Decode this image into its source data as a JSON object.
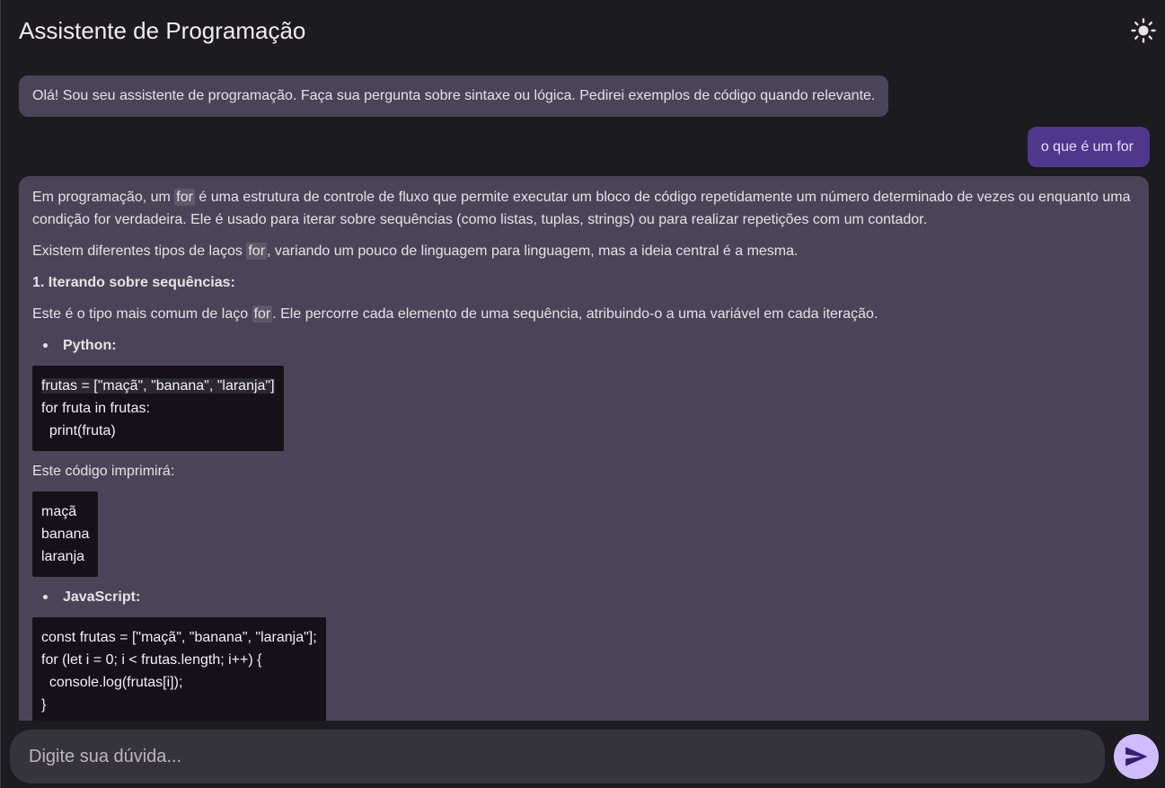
{
  "header": {
    "title": "Assistente de Programação",
    "theme_icon": "sun-icon"
  },
  "chat": {
    "greeting": "Olá! Sou seu assistente de programação. Faça sua pergunta sobre sintaxe ou lógica. Pedirei exemplos de código quando relevante.",
    "user_message": "o que é um for",
    "answer": {
      "p1_a": "Em programação, um ",
      "p1_code": "for",
      "p1_b": " é uma estrutura de controle de fluxo que permite executar um bloco de código repetidamente um número determinado de vezes ou enquanto uma condição for verdadeira.  Ele é usado para iterar sobre sequências (como listas, tuplas, strings) ou para realizar repetições com um contador.",
      "p2_a": "Existem diferentes tipos de laços ",
      "p2_code": "for",
      "p2_b": ", variando um pouco de linguagem para linguagem, mas a ideia central é a mesma.",
      "heading1": "1. Iterando sobre sequências:",
      "p3_a": "Este é o tipo mais comum de laço ",
      "p3_code": "for",
      "p3_b": ". Ele percorre cada elemento de uma sequência, atribuindo-o a uma variável em cada iteração.",
      "bullet_python": "Python:",
      "python_code": [
        "frutas = [\"maçã\", \"banana\", \"laranja\"]",
        "for fruta in frutas:",
        "  print(fruta)"
      ],
      "output_label": "Este código imprimirá:",
      "output_lines": [
        "maçã",
        "banana",
        "laranja"
      ],
      "bullet_js": "JavaScript:",
      "js_code": [
        "const frutas = [\"maçã\", \"banana\", \"laranja\"];",
        "for (let i = 0; i < frutas.length; i++) {",
        "  console.log(frutas[i]);",
        "}"
      ]
    }
  },
  "composer": {
    "placeholder": "Digite sua dúvida...",
    "send_icon": "send-icon"
  },
  "colors": {
    "background": "#1c1b1f",
    "bot_bubble": "#4a4458",
    "user_bubble": "#4f378b",
    "code_bg": "#141218",
    "send_button": "#d0bcff"
  }
}
